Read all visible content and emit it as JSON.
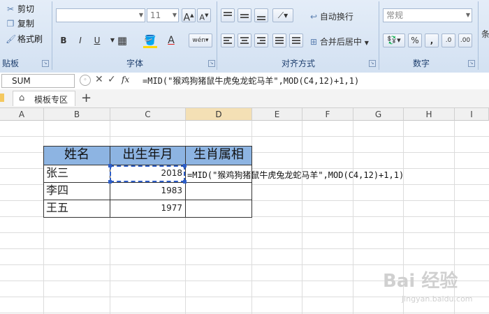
{
  "ribbon": {
    "clipboard": {
      "cut": "剪切",
      "copy": "复制",
      "format_painter": "格式刷",
      "title": "贴板"
    },
    "font": {
      "name": "",
      "size": "11",
      "grow": "A",
      "shrink": "A",
      "bold": "B",
      "italic": "I",
      "underline": "U",
      "phonetic": "wén",
      "title": "字体"
    },
    "alignment": {
      "wrap_text": "自动换行",
      "merge_center": "合并后居中",
      "title": "对齐方式"
    },
    "number": {
      "format": "常规",
      "percent": "%",
      "comma": ",",
      "title": "数字"
    },
    "cut_off_label": "条"
  },
  "formula_bar": {
    "name_box": "SUM",
    "cancel": "✕",
    "enter": "✓",
    "fx": "fx",
    "formula": "=MID(\"猴鸡狗猪鼠牛虎兔龙蛇马羊\",MOD(C4,12)+1,1)"
  },
  "tabs": {
    "template_tab": "模板专区",
    "add": "+"
  },
  "columns": [
    "A",
    "B",
    "C",
    "D",
    "E",
    "F",
    "G",
    "H",
    "I"
  ],
  "selected_column": "D",
  "table": {
    "headers": [
      "姓名",
      "出生年月",
      "生肖属相"
    ],
    "rows": [
      {
        "name": "张三",
        "year": "2018"
      },
      {
        "name": "李四",
        "year": "1983"
      },
      {
        "name": "王五",
        "year": "1977"
      }
    ],
    "editing_formula": "=MID(\"猴鸡狗猪鼠牛虎兔龙蛇马羊\",MOD(C4,12)+1,1)"
  },
  "watermark": {
    "logo": "Bai 经验",
    "url": "jingyan.baidu.com"
  }
}
